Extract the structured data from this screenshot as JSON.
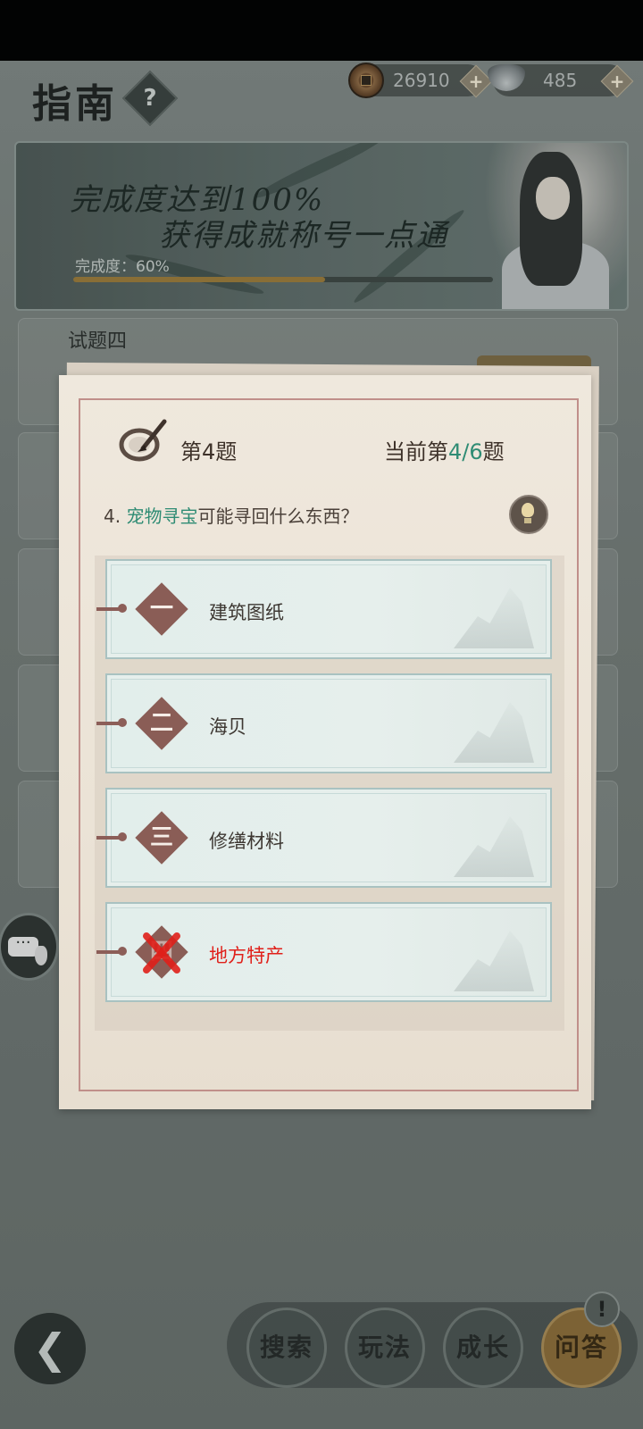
{
  "header": {
    "title": "指南",
    "help_label": "?",
    "coins": "26910",
    "ingots": "485",
    "plus": "+"
  },
  "banner": {
    "line1": "完成度达到100%",
    "line2": "获得成就称号一点通",
    "progress_label": "完成度：60%",
    "progress": 0.6
  },
  "background": {
    "section_title": "试题四"
  },
  "quiz": {
    "number_label": "第4题",
    "progress_prefix": "当前第",
    "progress_current": "4",
    "progress_sep": "/",
    "progress_total": "6",
    "progress_suffix": "题",
    "question_prefix": "4. ",
    "question_highlight": "宠物寻宝",
    "question_rest": "可能寻回什么东西？",
    "options": [
      {
        "mark": "一",
        "label": "建筑图纸",
        "state": "normal"
      },
      {
        "mark": "二",
        "label": "海贝",
        "state": "normal"
      },
      {
        "mark": "三",
        "label": "修缮材料",
        "state": "normal"
      },
      {
        "mark": "四",
        "label": "地方特产",
        "state": "wrong"
      }
    ]
  },
  "nav": {
    "back": "❮",
    "search": "搜索",
    "gameplay": "玩法",
    "growth": "成长",
    "qa": "问答",
    "alert": "!"
  },
  "colors": {
    "accent_green": "#2f8c74",
    "wrong_red": "#e0201a",
    "diamond": "#8a5d56",
    "paper": "#efe8dd"
  }
}
